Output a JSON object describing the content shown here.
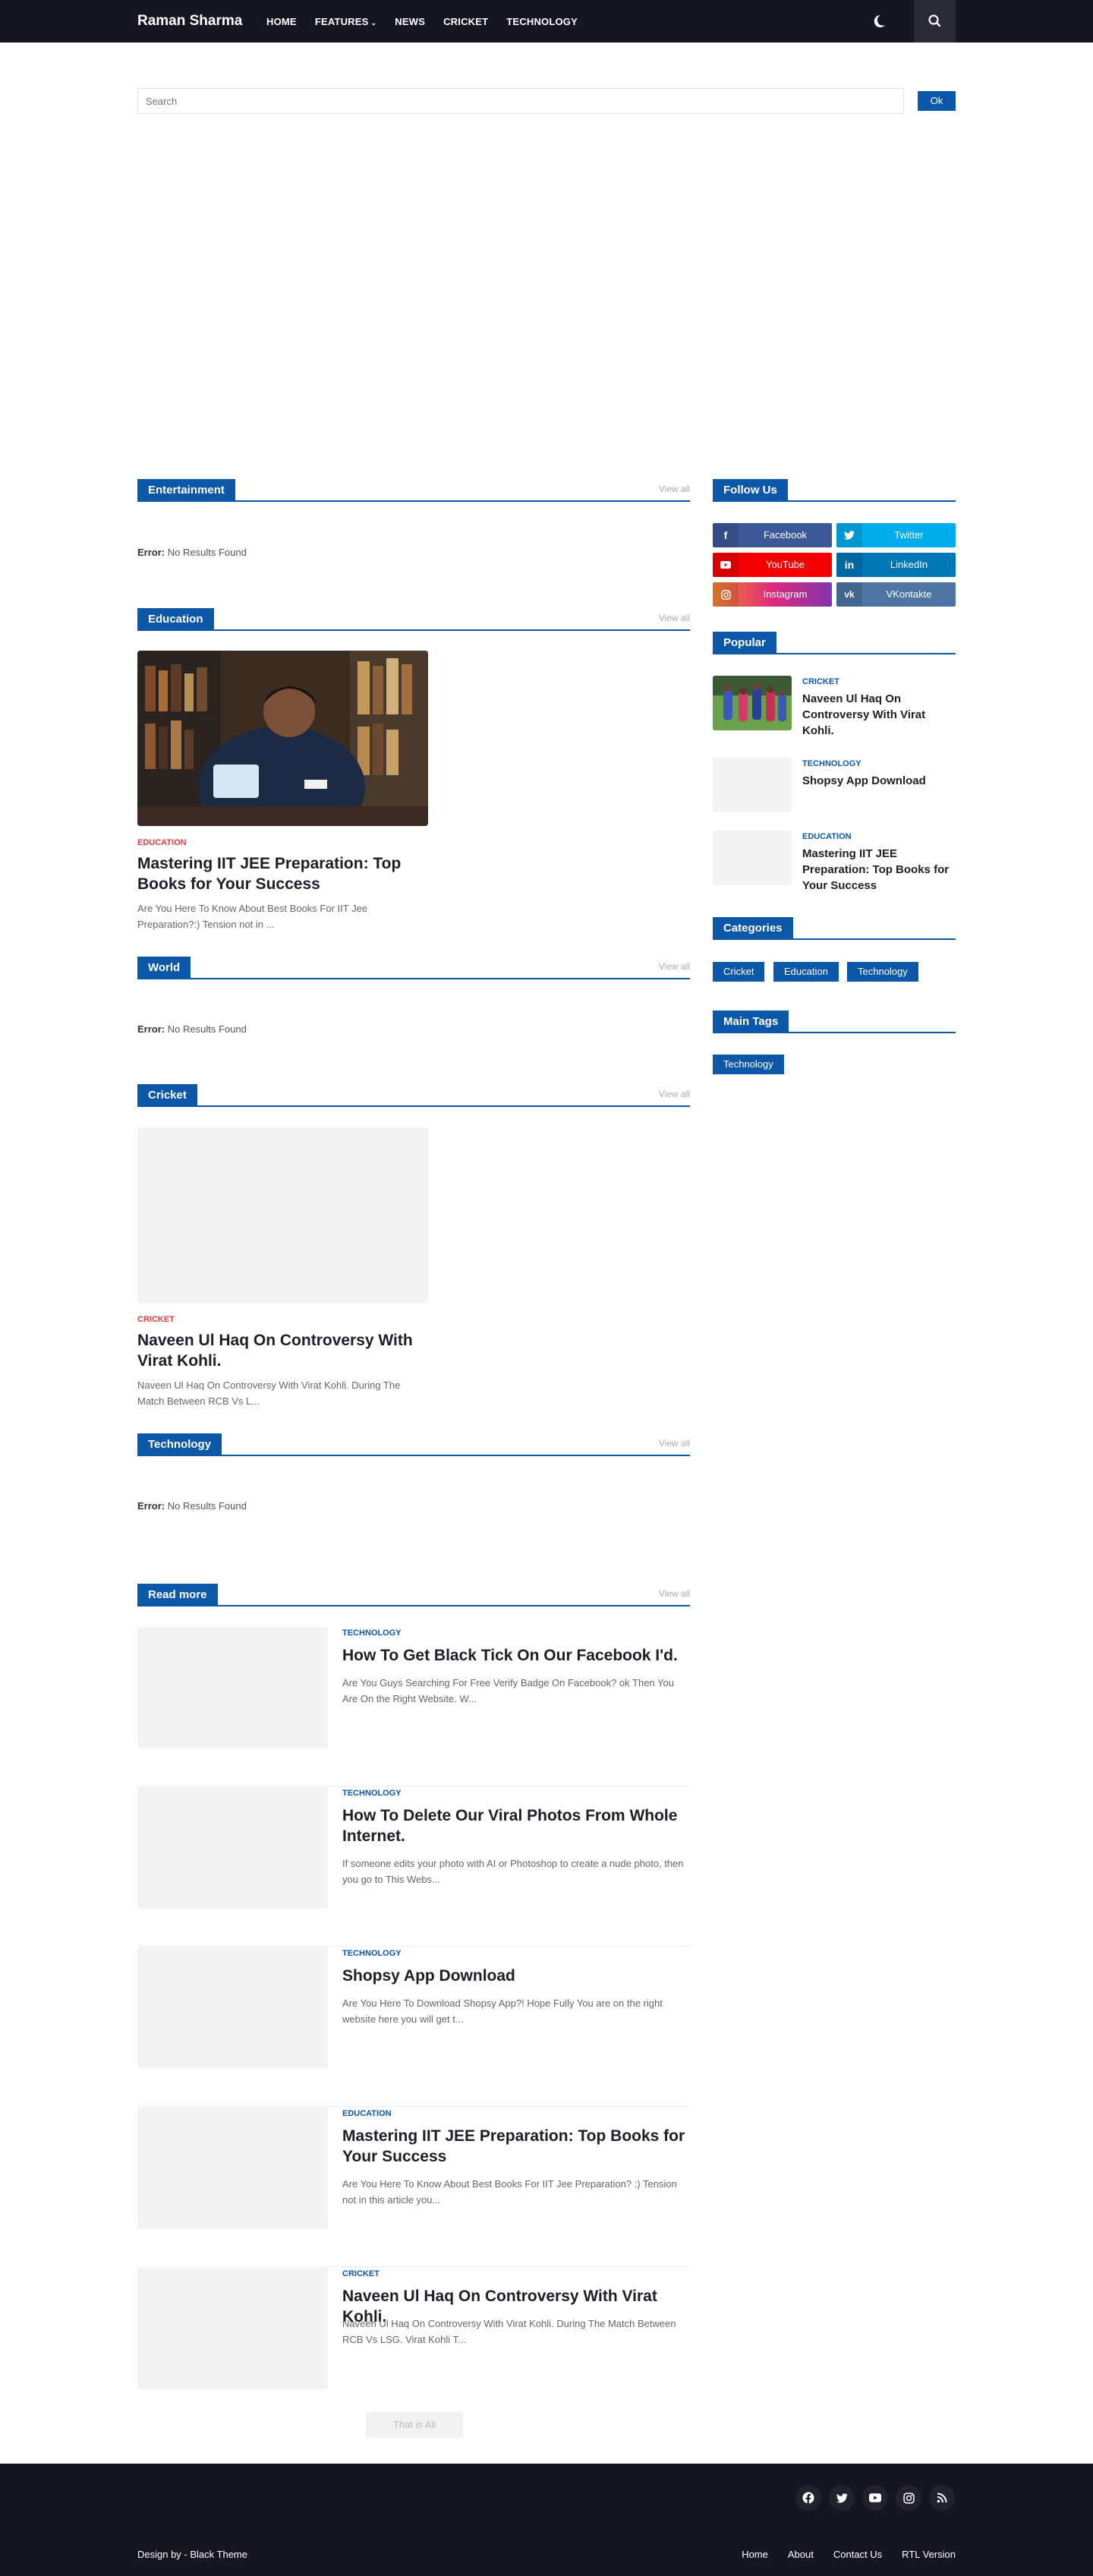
{
  "site": {
    "title": "Raman Sharma"
  },
  "nav": {
    "items": [
      {
        "label": "HOME"
      },
      {
        "label": "FEATURES"
      },
      {
        "label": "NEWS"
      },
      {
        "label": "CRICKET"
      },
      {
        "label": "TECHNOLOGY"
      }
    ]
  },
  "search": {
    "placeholder": "Search",
    "button_label": "Ok"
  },
  "sections": {
    "entertainment": {
      "title": "Entertainment",
      "view_all": "View all",
      "error_label": "Error:",
      "error_text": "No Results Found"
    },
    "education": {
      "title": "Education",
      "view_all": "View all",
      "post": {
        "category": "EDUCATION",
        "title": "Mastering IIT JEE Preparation: Top Books for Your Success",
        "snippet": "Are You Here To Know About Best Books For IIT Jee Preparation?:) Tension not in ..."
      }
    },
    "world": {
      "title": "World",
      "view_all": "View all",
      "error_label": "Error:",
      "error_text": "No Results Found"
    },
    "cricket": {
      "title": "Cricket",
      "view_all": "View all",
      "post": {
        "category": "CRICKET",
        "title": "Naveen Ul Haq On Controversy With Virat Kohli.",
        "snippet": "Naveen Ul Haq On Controversy With Virat Kohli. During The Match Between RCB Vs L..."
      }
    },
    "technology": {
      "title": "Technology",
      "view_all": "View all",
      "error_label": "Error:",
      "error_text": "No Results Found"
    }
  },
  "read_more": {
    "title": "Read more",
    "view_all": "View all",
    "items": [
      {
        "category": "TECHNOLOGY",
        "title": "How To Get Black Tick On Our Facebook I'd.",
        "snippet": "Are You Guys Searching For Free Verify Badge On Facebook? ok Then You Are On the Right Website. W..."
      },
      {
        "category": "TECHNOLOGY",
        "title": "How To Delete Our Viral Photos From Whole Internet.",
        "snippet": "If someone edits your photo with AI or Photoshop to create a nude photo, then you go to  This Webs..."
      },
      {
        "category": "TECHNOLOGY",
        "title": "Shopsy App Download",
        "snippet": "Are You Here To Download Shopsy App?! Hope Fully You are on the right website here you will get t..."
      },
      {
        "category": "EDUCATION",
        "title": "Mastering IIT JEE Preparation: Top Books for Your Success",
        "snippet": "Are You Here To Know About Best Books For IIT Jee Preparation? :) Tension not in this article you..."
      },
      {
        "category": "CRICKET",
        "title": "Naveen Ul Haq On Controversy With Virat Kohli.",
        "snippet": "Naveen Ul Haq On Controversy With Virat Kohli. During The Match Between RCB Vs LSG. Virat Kohli T..."
      }
    ],
    "end_label": "That is All"
  },
  "sidebar": {
    "follow_title": "Follow Us",
    "social": [
      {
        "label": "Facebook",
        "color": "#3b5999",
        "icon": "facebook-icon"
      },
      {
        "label": "Twitter",
        "color": "#00acee",
        "icon": "twitter-icon"
      },
      {
        "label": "YouTube",
        "color": "#f50000",
        "icon": "youtube-icon"
      },
      {
        "label": "LinkedIn",
        "color": "#0077b5",
        "icon": "linkedin-icon"
      },
      {
        "label": "Instagram",
        "color": "#dd2a7b",
        "icon": "instagram-icon"
      },
      {
        "label": "VKontakte",
        "color": "#4c75a3",
        "icon": "vk-icon"
      }
    ],
    "popular_title": "Popular",
    "popular": [
      {
        "category": "CRICKET",
        "title": "Naveen Ul Haq On Controversy With Virat Kohli."
      },
      {
        "category": "TECHNOLOGY",
        "title": "Shopsy App Download"
      },
      {
        "category": "EDUCATION",
        "title": "Mastering IIT JEE Preparation: Top Books for Your Success"
      }
    ],
    "categories_title": "Categories",
    "categories": [
      "Cricket",
      "Education",
      "Technology"
    ],
    "tags_title": "Main Tags",
    "tags": [
      "Technology"
    ]
  },
  "footer": {
    "credit": "Design by - Black Theme",
    "links": [
      "Home",
      "About",
      "Contact Us",
      "RTL Version"
    ],
    "social_icons": [
      "facebook-icon",
      "twitter-icon",
      "youtube-icon",
      "instagram-icon",
      "rss-icon"
    ]
  },
  "colors": {
    "accent": "#0c57a8",
    "header_bg": "#161622",
    "category_red": "#e03a3a"
  }
}
